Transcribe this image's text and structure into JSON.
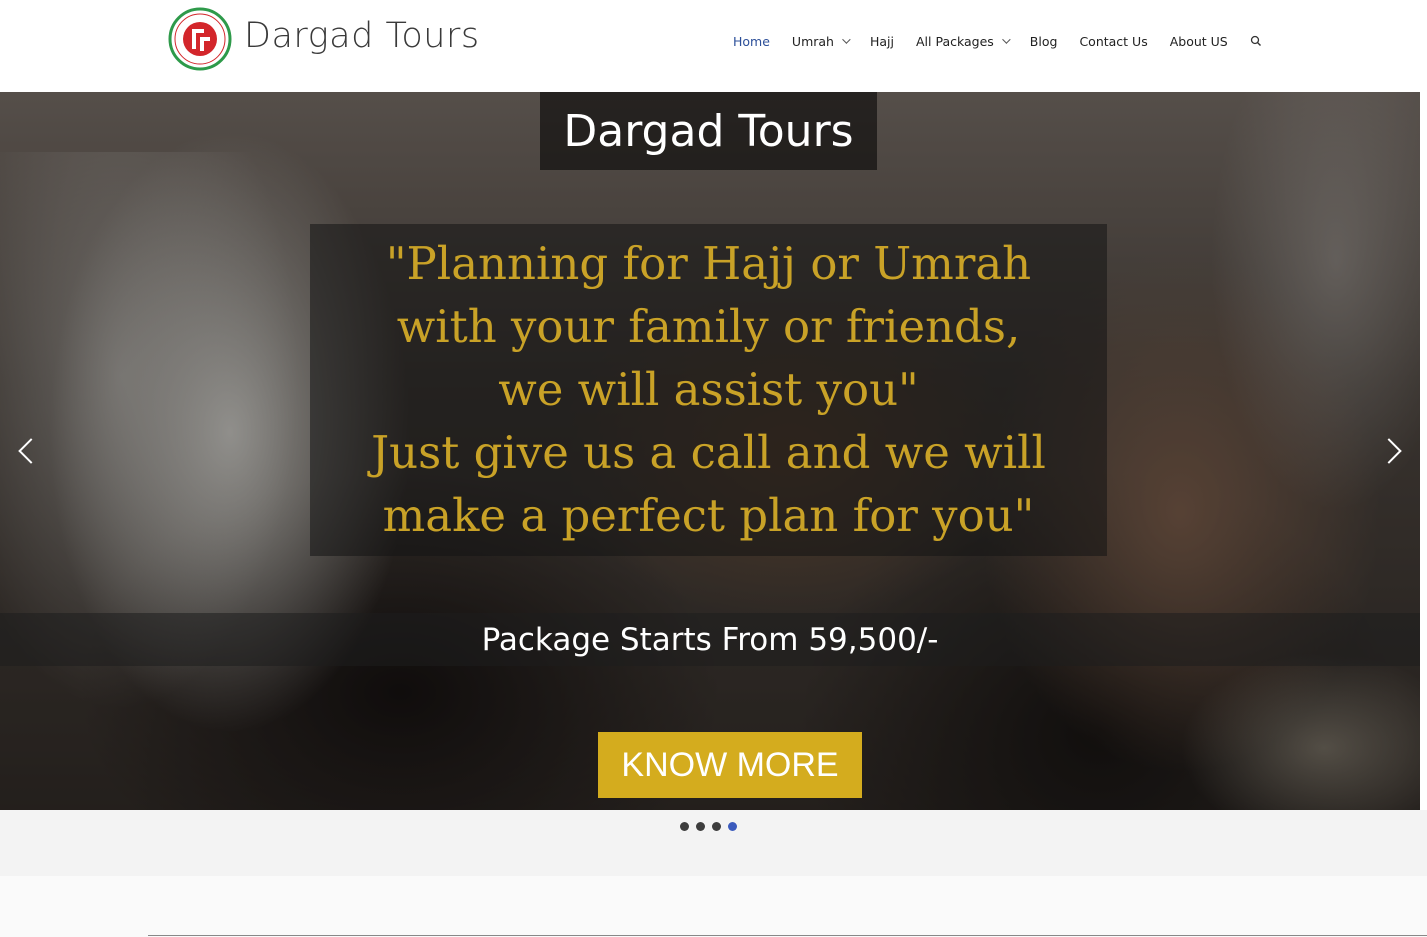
{
  "header": {
    "brand": "Dargad Tours",
    "logo_icon": "dargad-logo-icon",
    "nav": [
      {
        "label": "Home",
        "active": true,
        "dropdown": false
      },
      {
        "label": "Umrah",
        "active": false,
        "dropdown": true
      },
      {
        "label": "Hajj",
        "active": false,
        "dropdown": false
      },
      {
        "label": "All Packages",
        "active": false,
        "dropdown": true
      },
      {
        "label": "Blog",
        "active": false,
        "dropdown": false
      },
      {
        "label": "Contact Us",
        "active": false,
        "dropdown": false
      },
      {
        "label": "About US",
        "active": false,
        "dropdown": false
      }
    ],
    "search_icon": "search-icon"
  },
  "hero": {
    "title": "Dargad Tours",
    "quote": "\"Planning for Hajj or Umrah\nwith your family or friends,\nwe will assist you\"\nJust give us a call and we will\nmake a perfect plan for you\"",
    "price": "Package Starts From 59,500/-",
    "cta_label": "KNOW MORE",
    "prev_icon": "chevron-left-icon",
    "next_icon": "chevron-right-icon"
  },
  "slider": {
    "count": 4,
    "active_index": 3
  },
  "colors": {
    "nav_active": "#2c4f99",
    "quote_gold": "#c9a227",
    "cta_bg": "#d4ac1e",
    "dot_active": "#3b5bbd"
  }
}
